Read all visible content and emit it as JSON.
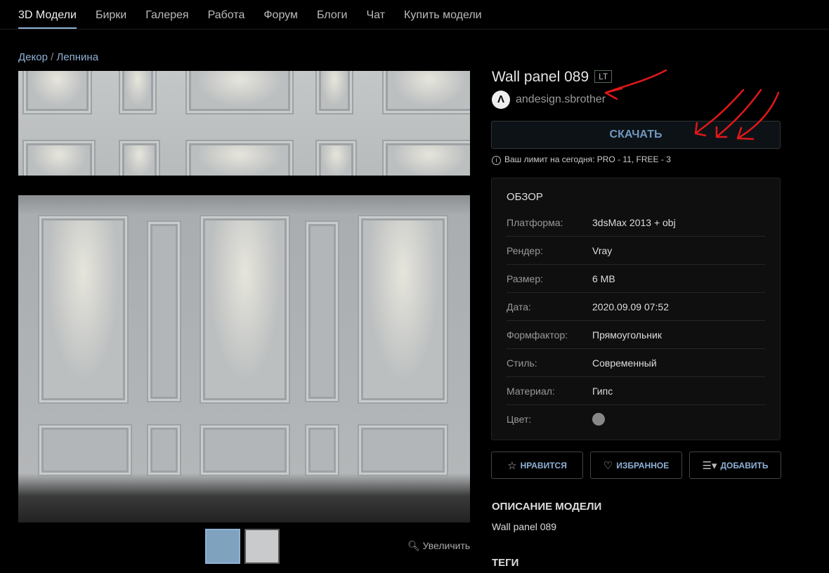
{
  "nav": {
    "items": [
      "3D Модели",
      "Бирки",
      "Галерея",
      "Работа",
      "Форум",
      "Блоги",
      "Чат",
      "Купить модели"
    ],
    "active": 0
  },
  "breadcrumb": {
    "parent": "Декор",
    "separator": "/",
    "current": "Лепнина"
  },
  "gallery": {
    "zoom_label": "Увеличить",
    "thumbnail_count": 2
  },
  "model": {
    "title": "Wall panel 089",
    "badge": "LT",
    "author": "andesign.sbrother",
    "author_avatar_letter": "Λ"
  },
  "download": {
    "label": "СКАЧАТЬ",
    "limit_text": "Ваш лимит на сегодня: PRO - 11, FREE - 3"
  },
  "overview": {
    "title": "ОБЗОР",
    "rows": [
      {
        "k": "Платформа:",
        "v": "3dsMax 2013 + obj"
      },
      {
        "k": "Рендер:",
        "v": "Vray"
      },
      {
        "k": "Размер:",
        "v": "6 MB"
      },
      {
        "k": "Дата:",
        "v": "2020.09.09 07:52"
      },
      {
        "k": "Формфактор:",
        "v": "Прямоугольник"
      },
      {
        "k": "Стиль:",
        "v": "Современный"
      },
      {
        "k": "Материал:",
        "v": "Гипс"
      },
      {
        "k": "Цвет:",
        "v": ""
      }
    ],
    "color_swatch": "#888888"
  },
  "actions": {
    "like": "НРАВИТСЯ",
    "favorite": "ИЗБРАННОЕ",
    "add": "ДОБАВИТЬ"
  },
  "description": {
    "title": "ОПИСАНИЕ МОДЕЛИ",
    "text": "Wall panel 089"
  },
  "tags": {
    "title": "ТЕГИ"
  },
  "colors": {
    "accent": "#8fb1d6",
    "annotation": "#e01818"
  }
}
